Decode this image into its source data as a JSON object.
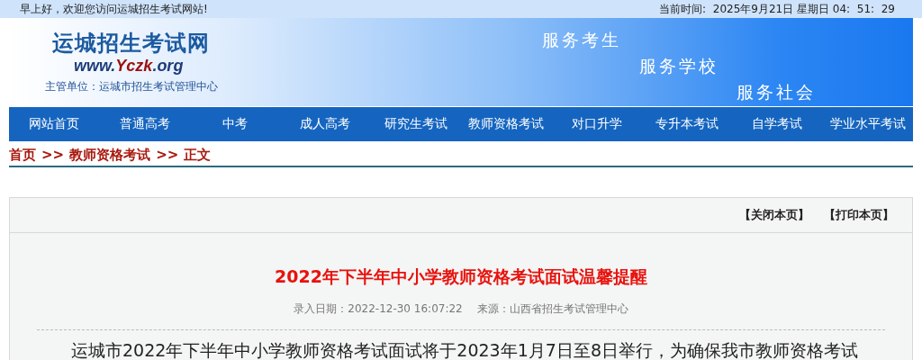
{
  "top_bar": {
    "greeting": "早上好，欢迎您访问运城招生考试网站!",
    "clock": "当前时间:  2025年9月21日 星期日 04:  51:  29"
  },
  "header": {
    "site_name": "运城招生考试网",
    "url": [
      {
        "text": "www.",
        "highlight": false
      },
      {
        "text": "Yczk",
        "highlight": true
      },
      {
        "text": ".org",
        "highlight": false
      }
    ],
    "authority": "主管单位：运城市招生考试管理中心",
    "slogans": [
      "服务考生",
      "服务学校",
      "服务社会"
    ]
  },
  "nav": [
    {
      "label": "网站首页"
    },
    {
      "label": "普通高考"
    },
    {
      "label": "中考"
    },
    {
      "label": "成人高考"
    },
    {
      "label": "研究生考试"
    },
    {
      "label": "教师资格考试"
    },
    {
      "label": "对口升学"
    },
    {
      "label": "专升本考试"
    },
    {
      "label": "自学考试"
    },
    {
      "label": "学业水平考试"
    }
  ],
  "breadcrumb": [
    "首页",
    ">>",
    "教师资格考试",
    ">>",
    "正文"
  ],
  "article": {
    "actions": [
      "【关闭本页】",
      "【打印本页】"
    ],
    "title": "2022年下半年中小学教师资格考试面试温馨提醒",
    "date": "录入日期：2022-12-30 16:07:22",
    "source": "来源：山西省招生考试管理中心",
    "body": "运城市2022年下半年中小学教师资格考试面试将于2023年1月7日至8日举行，为确保我市教师资格考试"
  }
}
